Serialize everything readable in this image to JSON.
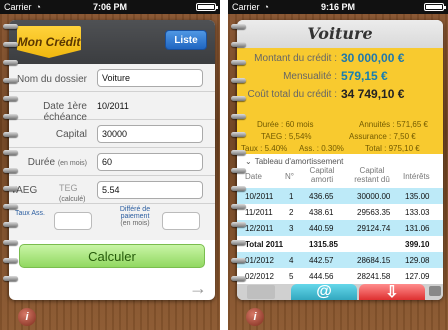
{
  "left": {
    "status": {
      "carrier": "Carrier",
      "time": "7:06 PM"
    },
    "app": {
      "title": "Mon Crédit",
      "list_button": "Liste"
    },
    "fields": {
      "name_label": "Nom du dossier",
      "name_value": "Voiture",
      "date_label": "Date 1ère échéance",
      "date_value": "10/2011",
      "capital_label": "Capital",
      "capital_value": "30000",
      "duration_label": "Durée",
      "duration_unit": "(en mois)",
      "duration_value": "60",
      "taeg_label": "TAEG",
      "teg_label": "TEG",
      "teg_sub": "(calculé)",
      "taeg_value": "5.54",
      "taux_label": "Taux Ass.",
      "payment_label": "Différé de paiement",
      "payment_sub": "(en mois)"
    },
    "actions": {
      "calculate": "Calculer",
      "info": "i",
      "next": "→"
    }
  },
  "right": {
    "status": {
      "carrier": "Carrier",
      "time": "9:16 PM"
    },
    "title": "Voiture",
    "summary": {
      "credit_amount_label": "Montant du crédit :",
      "credit_amount": "30 000,00 €",
      "monthly_label": "Mensualité :",
      "monthly": "579,15 €",
      "total_cost_label": "Coût total du crédit :",
      "total_cost": "34 749,10 €",
      "duration": "Durée : 60 mois",
      "annuities": "Annuités : 571,65 €",
      "taeg": "TAEG : 5,54%",
      "insurance": "Assurance : 7,50 €",
      "rate": "Taux : 5.40%",
      "ass": "Ass. : 0.30%",
      "total": "Total : 975,10 €"
    },
    "table_title": "Tableau d'amortissement",
    "headers": [
      "Date",
      "N°",
      "Capital amorti",
      "Capital restant dû",
      "Intérêts"
    ],
    "rows": [
      {
        "date": "10/2011",
        "n": "1",
        "amorti": "436.65",
        "restant": "30000.00",
        "interets": "135.00"
      },
      {
        "date": "11/2011",
        "n": "2",
        "amorti": "438.61",
        "restant": "29563.35",
        "interets": "133.03"
      },
      {
        "date": "12/2011",
        "n": "3",
        "amorti": "440.59",
        "restant": "29124.74",
        "interets": "131.06"
      },
      {
        "date": "Total 2011",
        "n": "",
        "amorti": "1315.85",
        "restant": "",
        "interets": "399.10"
      },
      {
        "date": "01/2012",
        "n": "4",
        "amorti": "442.57",
        "restant": "28684.15",
        "interets": "129.08"
      },
      {
        "date": "02/2012",
        "n": "5",
        "amorti": "444.56",
        "restant": "28241.58",
        "interets": "127.09"
      }
    ]
  }
}
